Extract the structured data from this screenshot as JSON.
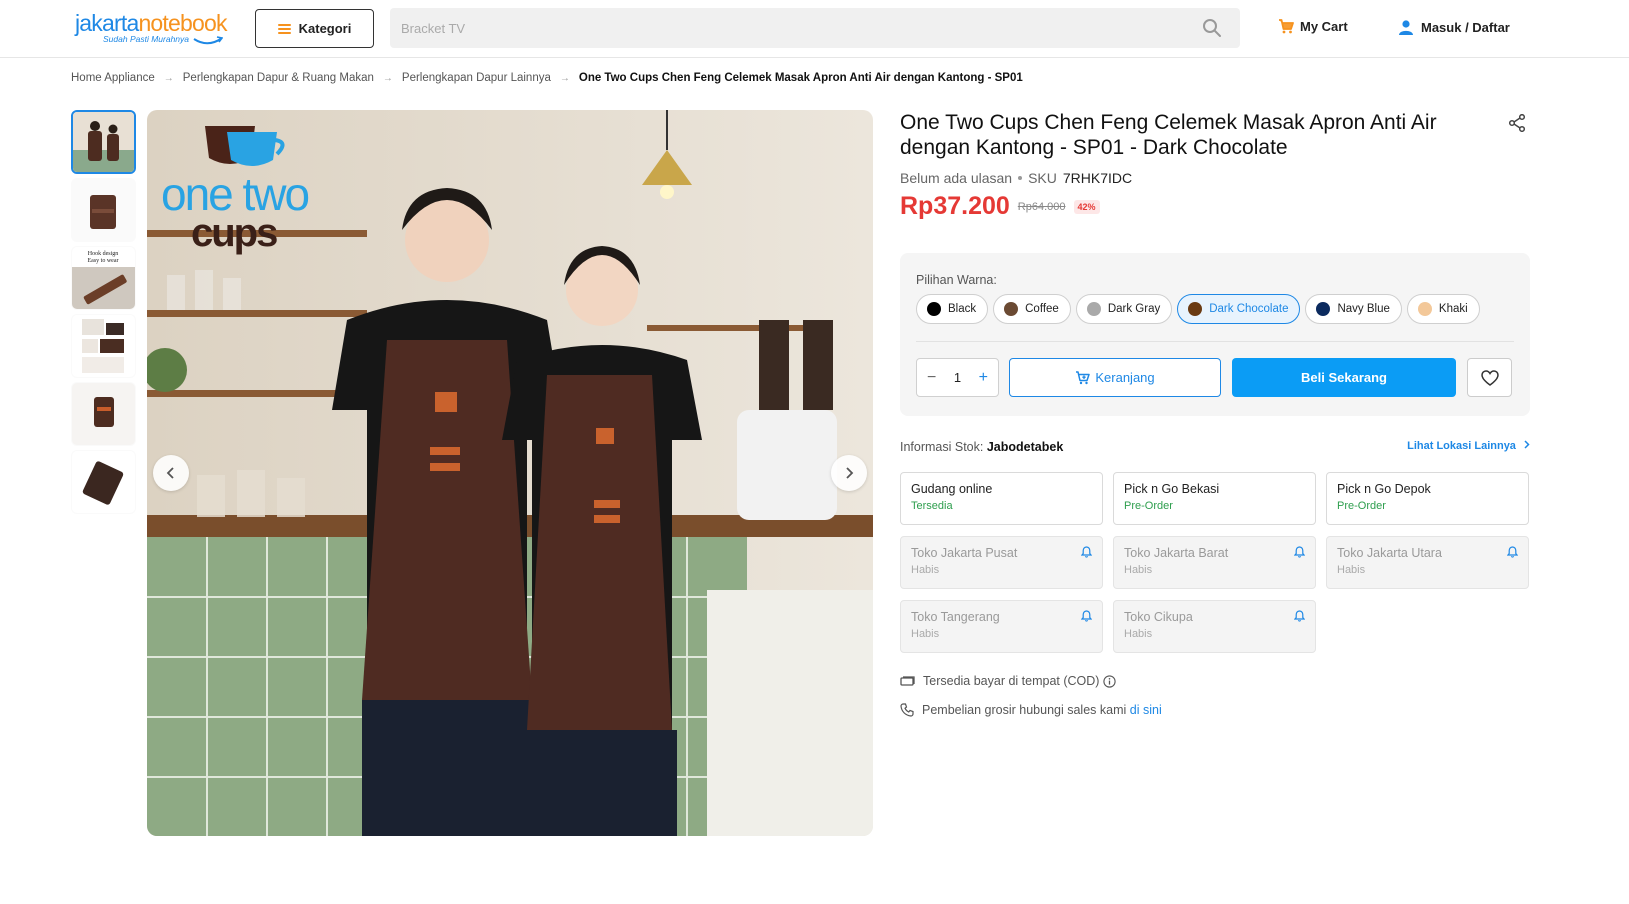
{
  "header": {
    "logo": {
      "part1": "jakarta",
      "part2": "notebook",
      "tagline": "Sudah Pasti Murahnya"
    },
    "kategori_label": "Kategori",
    "search": {
      "placeholder": "Bracket TV"
    },
    "cart_label": "My Cart",
    "login_label": "Masuk / Daftar",
    "colors": {
      "brand_blue": "#1e88e5",
      "brand_orange": "#f6921e"
    }
  },
  "breadcrumb": [
    "Home Appliance",
    "Perlengkapan Dapur & Ruang Makan",
    "Perlengkapan Dapur Lainnya",
    "One Two Cups Chen Feng Celemek Masak Apron Anti Air dengan Kantong - SP01"
  ],
  "gallery": {
    "thumb_text": {
      "hook_line1": "Hook design",
      "hook_line2": "Easy to wear"
    },
    "brand_overlay": {
      "line1": "one two",
      "line2": "cups"
    },
    "thumbnail_count": 6
  },
  "product": {
    "title": "One Two Cups Chen Feng Celemek Masak Apron Anti Air dengan Kantong - SP01 - Dark Chocolate",
    "review_text": "Belum ada ulasan",
    "sku_label": "SKU",
    "sku_value": "7RHK7IDC",
    "price": "Rp37.200",
    "old_price": "Rp64.000",
    "discount": "42%",
    "price_color": "#e53935"
  },
  "variants": {
    "label": "Pilihan Warna:",
    "options": [
      {
        "name": "Black",
        "color": "#000000",
        "selected": false
      },
      {
        "name": "Coffee",
        "color": "#6b4a33",
        "selected": false
      },
      {
        "name": "Dark Gray",
        "color": "#a9a9a9",
        "selected": false
      },
      {
        "name": "Dark Chocolate",
        "color": "#6a3a12",
        "selected": true
      },
      {
        "name": "Navy Blue",
        "color": "#0b2a5e",
        "selected": false
      },
      {
        "name": "Khaki",
        "color": "#f3c899",
        "selected": false
      }
    ]
  },
  "purchase": {
    "qty": "1",
    "keranjang_label": "Keranjang",
    "beli_label": "Beli Sekarang"
  },
  "stock": {
    "label": "Informasi Stok:",
    "location": "Jabodetabek",
    "more_label": "Lihat Lokasi Lainnya",
    "stores": [
      {
        "name": "Gudang online",
        "status": "Tersedia",
        "type": "ok"
      },
      {
        "name": "Pick n Go Bekasi",
        "status": "Pre-Order",
        "type": "po"
      },
      {
        "name": "Pick n Go Depok",
        "status": "Pre-Order",
        "type": "po"
      },
      {
        "name": "Toko Jakarta Pusat",
        "status": "Habis",
        "type": "out"
      },
      {
        "name": "Toko Jakarta Barat",
        "status": "Habis",
        "type": "out"
      },
      {
        "name": "Toko Jakarta Utara",
        "status": "Habis",
        "type": "out"
      },
      {
        "name": "Toko Tangerang",
        "status": "Habis",
        "type": "out"
      },
      {
        "name": "Toko Cikupa",
        "status": "Habis",
        "type": "out"
      }
    ]
  },
  "info": {
    "cod_text": "Tersedia bayar di tempat (COD)",
    "wholesale_text": "Pembelian grosir hubungi sales kami",
    "wholesale_link": "di sini"
  }
}
